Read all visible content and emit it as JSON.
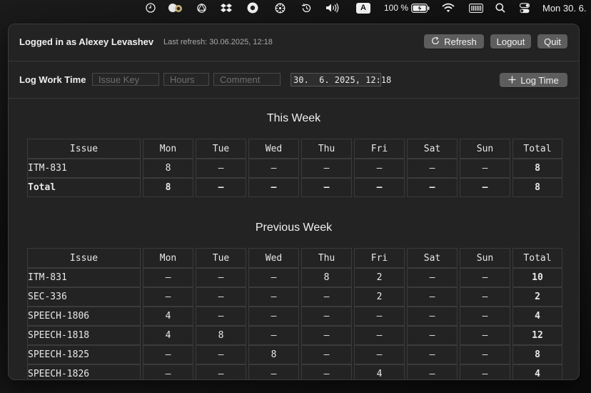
{
  "menubar": {
    "icons": [
      "clock-icon",
      "app-icon",
      "openai-icon",
      "dropbox-icon",
      "circle-app-icon",
      "settings-wheel-icon",
      "time-machine-icon",
      "volume-icon"
    ],
    "input_source": "A",
    "battery_text": "100 %",
    "icons_right": [
      "wifi-icon",
      "battery-bar-icon",
      "search-icon",
      "control-center-icon"
    ],
    "clock": "Mon 30. 6."
  },
  "header": {
    "logged_in": "Logged in as Alexey Levashev",
    "last_refresh": "Last refresh: 30.06.2025, 12:18",
    "refresh_label": "Refresh",
    "logout_label": "Logout",
    "quit_label": "Quit"
  },
  "log_form": {
    "title": "Log Work Time",
    "issue_placeholder": "Issue Key",
    "hours_placeholder": "Hours",
    "comment_placeholder": "Comment",
    "datetime": "30.  6. 2025, 12:18",
    "log_time_label": "Log Time"
  },
  "columns": [
    "Issue",
    "Mon",
    "Tue",
    "Wed",
    "Thu",
    "Fri",
    "Sat",
    "Sun",
    "Total"
  ],
  "this_week": {
    "title": "This Week",
    "rows": [
      [
        "ITM-831",
        "8",
        "–",
        "–",
        "–",
        "–",
        "–",
        "–",
        "8"
      ],
      [
        "Total",
        "8",
        "–",
        "–",
        "–",
        "–",
        "–",
        "–",
        "8"
      ]
    ]
  },
  "previous_week": {
    "title": "Previous Week",
    "rows": [
      [
        "ITM-831",
        "–",
        "–",
        "–",
        "8",
        "2",
        "–",
        "–",
        "10"
      ],
      [
        "SEC-336",
        "–",
        "–",
        "–",
        "–",
        "2",
        "–",
        "–",
        "2"
      ],
      [
        "SPEECH-1806",
        "4",
        "–",
        "–",
        "–",
        "–",
        "–",
        "–",
        "4"
      ],
      [
        "SPEECH-1818",
        "4",
        "8",
        "–",
        "–",
        "–",
        "–",
        "–",
        "12"
      ],
      [
        "SPEECH-1825",
        "–",
        "–",
        "8",
        "–",
        "–",
        "–",
        "–",
        "8"
      ],
      [
        "SPEECH-1826",
        "–",
        "–",
        "–",
        "–",
        "4",
        "–",
        "–",
        "4"
      ]
    ]
  }
}
